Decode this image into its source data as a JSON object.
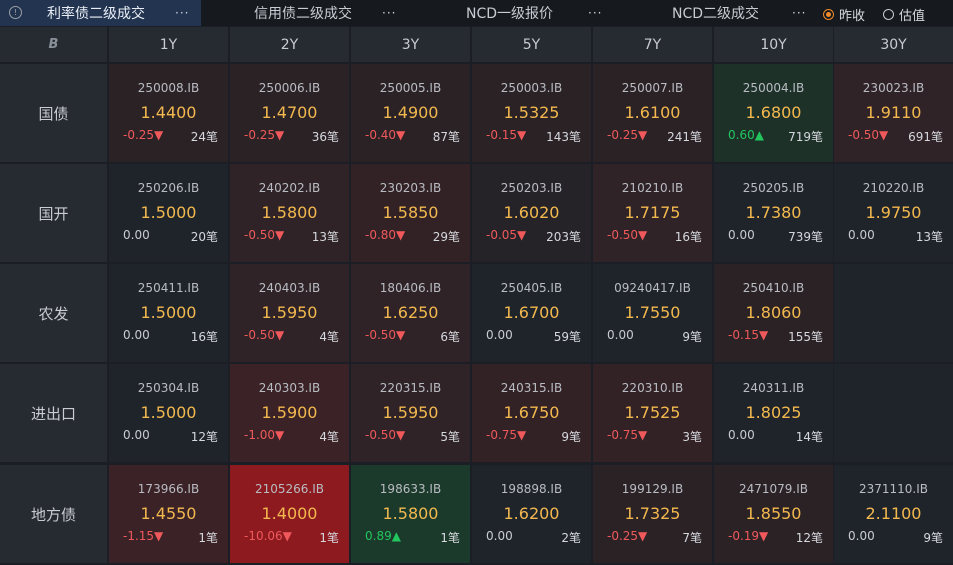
{
  "tabs": [
    {
      "label": "利率债二级成交",
      "active": true
    },
    {
      "label": "信用债二级成交",
      "active": false
    },
    {
      "label": "NCD一级报价",
      "active": false
    },
    {
      "label": "NCD二级成交",
      "active": false
    }
  ],
  "tab_menu_icon": "···",
  "radio": {
    "options": [
      {
        "label": "昨收",
        "checked": true
      },
      {
        "label": "估值",
        "checked": false
      }
    ]
  },
  "corner_icon": "B",
  "tenors": [
    "1Y",
    "2Y",
    "3Y",
    "5Y",
    "7Y",
    "10Y",
    "30Y"
  ],
  "rows": [
    {
      "label": "国债",
      "cells": [
        {
          "code": "250008.IB",
          "yield": "1.4400",
          "change": "-0.25",
          "dir": "down",
          "count": "24笔",
          "bg": "#2b2226"
        },
        {
          "code": "250006.IB",
          "yield": "1.4700",
          "change": "-0.25",
          "dir": "down",
          "count": "36笔",
          "bg": "#2b2226"
        },
        {
          "code": "250005.IB",
          "yield": "1.4900",
          "change": "-0.40",
          "dir": "down",
          "count": "87笔",
          "bg": "#2b2226"
        },
        {
          "code": "250003.IB",
          "yield": "1.5325",
          "change": "-0.15",
          "dir": "down",
          "count": "143笔",
          "bg": "#2b2226"
        },
        {
          "code": "250007.IB",
          "yield": "1.6100",
          "change": "-0.25",
          "dir": "down",
          "count": "241笔",
          "bg": "#2b2226"
        },
        {
          "code": "250004.IB",
          "yield": "1.6800",
          "change": "0.60",
          "dir": "up",
          "count": "719笔",
          "bg": "#1d3129"
        },
        {
          "code": "230023.IB",
          "yield": "1.9110",
          "change": "-0.50",
          "dir": "down",
          "count": "691笔",
          "bg": "#2f2327"
        }
      ]
    },
    {
      "label": "国开",
      "cells": [
        {
          "code": "250206.IB",
          "yield": "1.5000",
          "change": "0.00",
          "dir": "flat",
          "count": "20笔",
          "bg": "#1f242b"
        },
        {
          "code": "240202.IB",
          "yield": "1.5800",
          "change": "-0.50",
          "dir": "down",
          "count": "13笔",
          "bg": "#2f2327"
        },
        {
          "code": "230203.IB",
          "yield": "1.5850",
          "change": "-0.80",
          "dir": "down",
          "count": "29笔",
          "bg": "#322226"
        },
        {
          "code": "250203.IB",
          "yield": "1.6020",
          "change": "-0.05",
          "dir": "down",
          "count": "203笔",
          "bg": "#262328"
        },
        {
          "code": "210210.IB",
          "yield": "1.7175",
          "change": "-0.50",
          "dir": "down",
          "count": "16笔",
          "bg": "#2f2327"
        },
        {
          "code": "250205.IB",
          "yield": "1.7380",
          "change": "0.00",
          "dir": "flat",
          "count": "739笔",
          "bg": "#1f242b"
        },
        {
          "code": "210220.IB",
          "yield": "1.9750",
          "change": "0.00",
          "dir": "flat",
          "count": "13笔",
          "bg": "#1f242b"
        }
      ]
    },
    {
      "label": "农发",
      "cells": [
        {
          "code": "250411.IB",
          "yield": "1.5000",
          "change": "0.00",
          "dir": "flat",
          "count": "16笔",
          "bg": "#1f242b"
        },
        {
          "code": "240403.IB",
          "yield": "1.5950",
          "change": "-0.50",
          "dir": "down",
          "count": "4笔",
          "bg": "#2f2327"
        },
        {
          "code": "180406.IB",
          "yield": "1.6250",
          "change": "-0.50",
          "dir": "down",
          "count": "6笔",
          "bg": "#2f2327"
        },
        {
          "code": "250405.IB",
          "yield": "1.6700",
          "change": "0.00",
          "dir": "flat",
          "count": "59笔",
          "bg": "#1f242b"
        },
        {
          "code": "09240417.IB",
          "yield": "1.7550",
          "change": "0.00",
          "dir": "flat",
          "count": "9笔",
          "bg": "#1f242b"
        },
        {
          "code": "250410.IB",
          "yield": "1.8060",
          "change": "-0.15",
          "dir": "down",
          "count": "155笔",
          "bg": "#2b2226"
        },
        null
      ]
    },
    {
      "label": "进出口",
      "cells": [
        {
          "code": "250304.IB",
          "yield": "1.5000",
          "change": "0.00",
          "dir": "flat",
          "count": "12笔",
          "bg": "#1f242b"
        },
        {
          "code": "240303.IB",
          "yield": "1.5900",
          "change": "-1.00",
          "dir": "down",
          "count": "4笔",
          "bg": "#3a2226"
        },
        {
          "code": "220315.IB",
          "yield": "1.5950",
          "change": "-0.50",
          "dir": "down",
          "count": "5笔",
          "bg": "#2f2327"
        },
        {
          "code": "240315.IB",
          "yield": "1.6750",
          "change": "-0.75",
          "dir": "down",
          "count": "9笔",
          "bg": "#322226"
        },
        {
          "code": "220310.IB",
          "yield": "1.7525",
          "change": "-0.75",
          "dir": "down",
          "count": "3笔",
          "bg": "#322226"
        },
        {
          "code": "240311.IB",
          "yield": "1.8025",
          "change": "0.00",
          "dir": "flat",
          "count": "14笔",
          "bg": "#1f242b"
        },
        null
      ]
    },
    {
      "label": "地方债",
      "cells": [
        {
          "code": "173966.IB",
          "yield": "1.4550",
          "change": "-1.15",
          "dir": "down",
          "count": "1笔",
          "bg": "#3a2226"
        },
        {
          "code": "2105266.IB",
          "yield": "1.4000",
          "change": "-10.06",
          "dir": "down",
          "count": "1笔",
          "bg": "#8c1a1f"
        },
        {
          "code": "198633.IB",
          "yield": "1.5800",
          "change": "0.89",
          "dir": "up",
          "count": "1笔",
          "bg": "#1b3a2b"
        },
        {
          "code": "198898.IB",
          "yield": "1.6200",
          "change": "0.00",
          "dir": "flat",
          "count": "2笔",
          "bg": "#1f242b"
        },
        {
          "code": "199129.IB",
          "yield": "1.7325",
          "change": "-0.25",
          "dir": "down",
          "count": "7笔",
          "bg": "#2b2226"
        },
        {
          "code": "2471079.IB",
          "yield": "1.8550",
          "change": "-0.19",
          "dir": "down",
          "count": "12笔",
          "bg": "#2b2226"
        },
        {
          "code": "2371110.IB",
          "yield": "2.1100",
          "change": "0.00",
          "dir": "flat",
          "count": "9笔",
          "bg": "#1f242b"
        }
      ]
    }
  ]
}
